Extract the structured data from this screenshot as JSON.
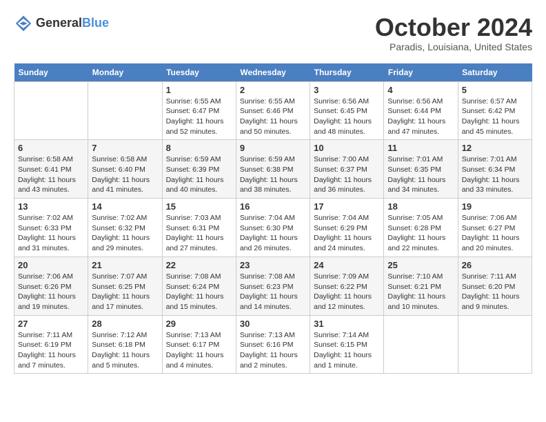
{
  "header": {
    "logo_general": "General",
    "logo_blue": "Blue",
    "month_title": "October 2024",
    "location": "Paradis, Louisiana, United States"
  },
  "days_of_week": [
    "Sunday",
    "Monday",
    "Tuesday",
    "Wednesday",
    "Thursday",
    "Friday",
    "Saturday"
  ],
  "weeks": [
    [
      {
        "day": "",
        "sunrise": "",
        "sunset": "",
        "daylight": ""
      },
      {
        "day": "",
        "sunrise": "",
        "sunset": "",
        "daylight": ""
      },
      {
        "day": "1",
        "sunrise": "Sunrise: 6:55 AM",
        "sunset": "Sunset: 6:47 PM",
        "daylight": "Daylight: 11 hours and 52 minutes."
      },
      {
        "day": "2",
        "sunrise": "Sunrise: 6:55 AM",
        "sunset": "Sunset: 6:46 PM",
        "daylight": "Daylight: 11 hours and 50 minutes."
      },
      {
        "day": "3",
        "sunrise": "Sunrise: 6:56 AM",
        "sunset": "Sunset: 6:45 PM",
        "daylight": "Daylight: 11 hours and 48 minutes."
      },
      {
        "day": "4",
        "sunrise": "Sunrise: 6:56 AM",
        "sunset": "Sunset: 6:44 PM",
        "daylight": "Daylight: 11 hours and 47 minutes."
      },
      {
        "day": "5",
        "sunrise": "Sunrise: 6:57 AM",
        "sunset": "Sunset: 6:42 PM",
        "daylight": "Daylight: 11 hours and 45 minutes."
      }
    ],
    [
      {
        "day": "6",
        "sunrise": "Sunrise: 6:58 AM",
        "sunset": "Sunset: 6:41 PM",
        "daylight": "Daylight: 11 hours and 43 minutes."
      },
      {
        "day": "7",
        "sunrise": "Sunrise: 6:58 AM",
        "sunset": "Sunset: 6:40 PM",
        "daylight": "Daylight: 11 hours and 41 minutes."
      },
      {
        "day": "8",
        "sunrise": "Sunrise: 6:59 AM",
        "sunset": "Sunset: 6:39 PM",
        "daylight": "Daylight: 11 hours and 40 minutes."
      },
      {
        "day": "9",
        "sunrise": "Sunrise: 6:59 AM",
        "sunset": "Sunset: 6:38 PM",
        "daylight": "Daylight: 11 hours and 38 minutes."
      },
      {
        "day": "10",
        "sunrise": "Sunrise: 7:00 AM",
        "sunset": "Sunset: 6:37 PM",
        "daylight": "Daylight: 11 hours and 36 minutes."
      },
      {
        "day": "11",
        "sunrise": "Sunrise: 7:01 AM",
        "sunset": "Sunset: 6:35 PM",
        "daylight": "Daylight: 11 hours and 34 minutes."
      },
      {
        "day": "12",
        "sunrise": "Sunrise: 7:01 AM",
        "sunset": "Sunset: 6:34 PM",
        "daylight": "Daylight: 11 hours and 33 minutes."
      }
    ],
    [
      {
        "day": "13",
        "sunrise": "Sunrise: 7:02 AM",
        "sunset": "Sunset: 6:33 PM",
        "daylight": "Daylight: 11 hours and 31 minutes."
      },
      {
        "day": "14",
        "sunrise": "Sunrise: 7:02 AM",
        "sunset": "Sunset: 6:32 PM",
        "daylight": "Daylight: 11 hours and 29 minutes."
      },
      {
        "day": "15",
        "sunrise": "Sunrise: 7:03 AM",
        "sunset": "Sunset: 6:31 PM",
        "daylight": "Daylight: 11 hours and 27 minutes."
      },
      {
        "day": "16",
        "sunrise": "Sunrise: 7:04 AM",
        "sunset": "Sunset: 6:30 PM",
        "daylight": "Daylight: 11 hours and 26 minutes."
      },
      {
        "day": "17",
        "sunrise": "Sunrise: 7:04 AM",
        "sunset": "Sunset: 6:29 PM",
        "daylight": "Daylight: 11 hours and 24 minutes."
      },
      {
        "day": "18",
        "sunrise": "Sunrise: 7:05 AM",
        "sunset": "Sunset: 6:28 PM",
        "daylight": "Daylight: 11 hours and 22 minutes."
      },
      {
        "day": "19",
        "sunrise": "Sunrise: 7:06 AM",
        "sunset": "Sunset: 6:27 PM",
        "daylight": "Daylight: 11 hours and 20 minutes."
      }
    ],
    [
      {
        "day": "20",
        "sunrise": "Sunrise: 7:06 AM",
        "sunset": "Sunset: 6:26 PM",
        "daylight": "Daylight: 11 hours and 19 minutes."
      },
      {
        "day": "21",
        "sunrise": "Sunrise: 7:07 AM",
        "sunset": "Sunset: 6:25 PM",
        "daylight": "Daylight: 11 hours and 17 minutes."
      },
      {
        "day": "22",
        "sunrise": "Sunrise: 7:08 AM",
        "sunset": "Sunset: 6:24 PM",
        "daylight": "Daylight: 11 hours and 15 minutes."
      },
      {
        "day": "23",
        "sunrise": "Sunrise: 7:08 AM",
        "sunset": "Sunset: 6:23 PM",
        "daylight": "Daylight: 11 hours and 14 minutes."
      },
      {
        "day": "24",
        "sunrise": "Sunrise: 7:09 AM",
        "sunset": "Sunset: 6:22 PM",
        "daylight": "Daylight: 11 hours and 12 minutes."
      },
      {
        "day": "25",
        "sunrise": "Sunrise: 7:10 AM",
        "sunset": "Sunset: 6:21 PM",
        "daylight": "Daylight: 11 hours and 10 minutes."
      },
      {
        "day": "26",
        "sunrise": "Sunrise: 7:11 AM",
        "sunset": "Sunset: 6:20 PM",
        "daylight": "Daylight: 11 hours and 9 minutes."
      }
    ],
    [
      {
        "day": "27",
        "sunrise": "Sunrise: 7:11 AM",
        "sunset": "Sunset: 6:19 PM",
        "daylight": "Daylight: 11 hours and 7 minutes."
      },
      {
        "day": "28",
        "sunrise": "Sunrise: 7:12 AM",
        "sunset": "Sunset: 6:18 PM",
        "daylight": "Daylight: 11 hours and 5 minutes."
      },
      {
        "day": "29",
        "sunrise": "Sunrise: 7:13 AM",
        "sunset": "Sunset: 6:17 PM",
        "daylight": "Daylight: 11 hours and 4 minutes."
      },
      {
        "day": "30",
        "sunrise": "Sunrise: 7:13 AM",
        "sunset": "Sunset: 6:16 PM",
        "daylight": "Daylight: 11 hours and 2 minutes."
      },
      {
        "day": "31",
        "sunrise": "Sunrise: 7:14 AM",
        "sunset": "Sunset: 6:15 PM",
        "daylight": "Daylight: 11 hours and 1 minute."
      },
      {
        "day": "",
        "sunrise": "",
        "sunset": "",
        "daylight": ""
      },
      {
        "day": "",
        "sunrise": "",
        "sunset": "",
        "daylight": ""
      }
    ]
  ]
}
